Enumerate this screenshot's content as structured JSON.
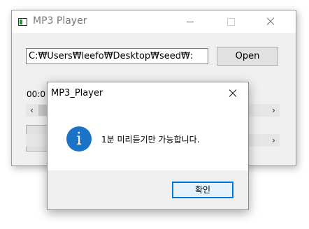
{
  "main_window": {
    "title": "MP3 Player",
    "path_value": "C:₩Users₩leefo₩Desktop₩seed₩:",
    "open_label": "Open",
    "time_text": "00:0"
  },
  "dialog": {
    "title": "MP3_Player",
    "message": "1분 미리듣기만 가능합니다.",
    "ok_label": "확인",
    "icon": "information-icon"
  },
  "colors": {
    "info_blue": "#1a73c6",
    "focus_border": "#0078d7"
  }
}
